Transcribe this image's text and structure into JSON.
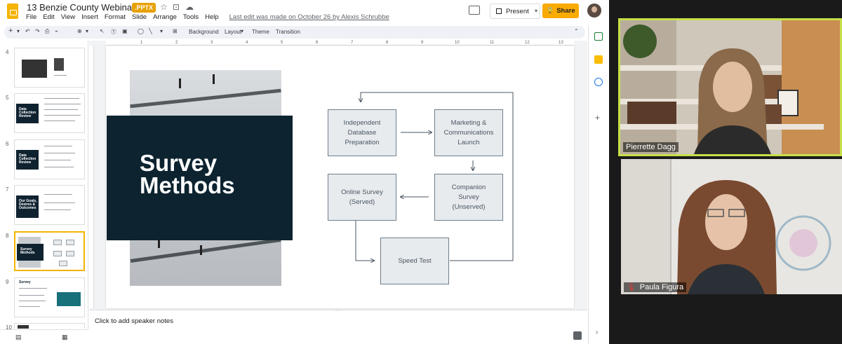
{
  "app": {
    "doc_title": "13 Benzie County Webinar PPT",
    "file_badge": ".PPTX",
    "menu": [
      "File",
      "Edit",
      "View",
      "Insert",
      "Format",
      "Slide",
      "Arrange",
      "Tools",
      "Help"
    ],
    "last_edit": "Last edit was made on October 26 by Alexis Schrubbe",
    "present_label": "Present",
    "share_label": "Share"
  },
  "toolbar": {
    "background_label": "Background",
    "layout_label": "Layout",
    "theme_label": "Theme",
    "transition_label": "Transition"
  },
  "ruler": [
    "1",
    "2",
    "3",
    "4",
    "5",
    "6",
    "7",
    "8",
    "9",
    "10",
    "11",
    "12",
    "13"
  ],
  "filmstrip": {
    "slides": [
      {
        "num": "4",
        "title": ""
      },
      {
        "num": "5",
        "title": "Data Collection Review"
      },
      {
        "num": "6",
        "title": "Data Collection Review"
      },
      {
        "num": "7",
        "title": "Our Goals, Desires & Outcomes"
      },
      {
        "num": "8",
        "title": "Survey Methods"
      },
      {
        "num": "9",
        "title": "Survey"
      },
      {
        "num": "10",
        "title": ""
      }
    ]
  },
  "slide": {
    "title": "Survey\nMethods",
    "flow": {
      "box1": "Independent\nDatabase\nPreparation",
      "box2": "Marketing &\nCommunications\nLaunch",
      "box3": "Companion\nSurvey\n(Unserved)",
      "box4": "Online Survey\n(Served)",
      "box5": "Speed Test"
    }
  },
  "notes_placeholder": "Click to add speaker notes",
  "participants": [
    {
      "name": "Pierrette Dagg",
      "active_speaker": true
    },
    {
      "name": "Paula Figura",
      "muted": true
    }
  ],
  "colors": {
    "accent": "#f9ab00",
    "slide_dark": "#0d2330",
    "active_speaker_border": "#c6e04a",
    "muted_icon": "#e53935"
  }
}
